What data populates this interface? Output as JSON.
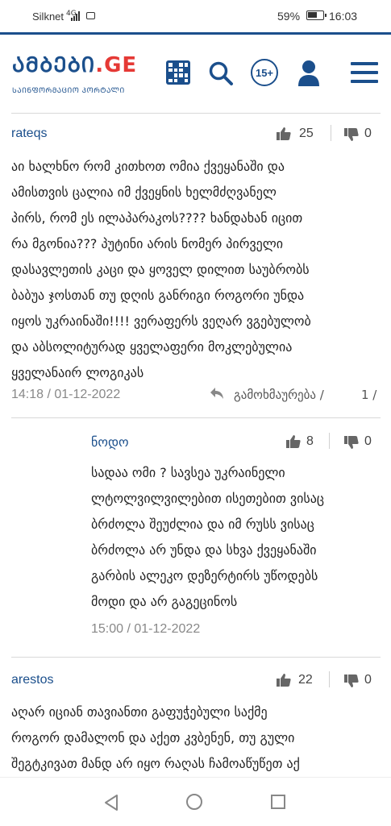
{
  "status_bar": {
    "carrier": "Silknet",
    "network": "4G",
    "battery": "59%",
    "time": "16:03"
  },
  "header": {
    "logo_main": "ᲐᲛᲑᲔᲑᲘ",
    "logo_suffix": ".GE",
    "logo_sub": "ᲡᲐᲘᲜᲤᲝᲠᲛᲐᲪᲘᲝ ᲞᲝᲠᲢᲐᲚᲘ",
    "age_badge": "15+"
  },
  "comments": [
    {
      "user": "rateqs",
      "likes": "25",
      "dislikes": "0",
      "text": "აი ხალხნო რომ კითხოთ ომია ქვეყანაში და\nამისთვის ცალია იმ ქვეყნის ხელმძღვანელ\nპირს, რომ ეს ილაპარაკოს???? ხანდახან იცით\nრა მგონია??? პუტინი არის ნომერ პირველი\nდასავლეთის კაცი და ყოველ დილით საუბრობს\nბაბუა ჯოსთან თუ დღის განრიგი როგორი უნდა\nიყოს უკრაინაში!!!! ვერაფერს ვეღარ ვგებულობ\nდა აბსოლიტურად ყველაფერი მოკლებულია\nყველანაირ ლოგიკას",
      "datetime": "14:18 / 01-12-2022",
      "reply_label": "გამოხმაურება /",
      "reply_count": "1 /"
    },
    {
      "user": "ნოდო",
      "likes": "8",
      "dislikes": "0",
      "text": "სადაა ომი ? სავსეა უკრაინელი\nლტოლვილვილებით ისეთებით ვისაც\nბრძოლა შეუძლია და იმ რუსს ვისაც\nბრძოლა არ უნდა და სხვა ქვეყანაში\nგარბის ალეკო დეზერტირს უწოდებს\nმოდი და არ გაგეცინოს",
      "datetime": "15:00 / 01-12-2022"
    },
    {
      "user": "arestos",
      "likes": "22",
      "dislikes": "0",
      "text": "აღარ იციან თავიანთი გაფუჭებული საქმე\nროგორ დამალონ და აქეთ კვბენენ, თუ გული\nშეგტკივათ მანდ არ იყო რაღას ჩამოაწუწეთ აქ"
    }
  ],
  "colors": {
    "brand": "#1b4f8c",
    "accent": "#e53935"
  }
}
